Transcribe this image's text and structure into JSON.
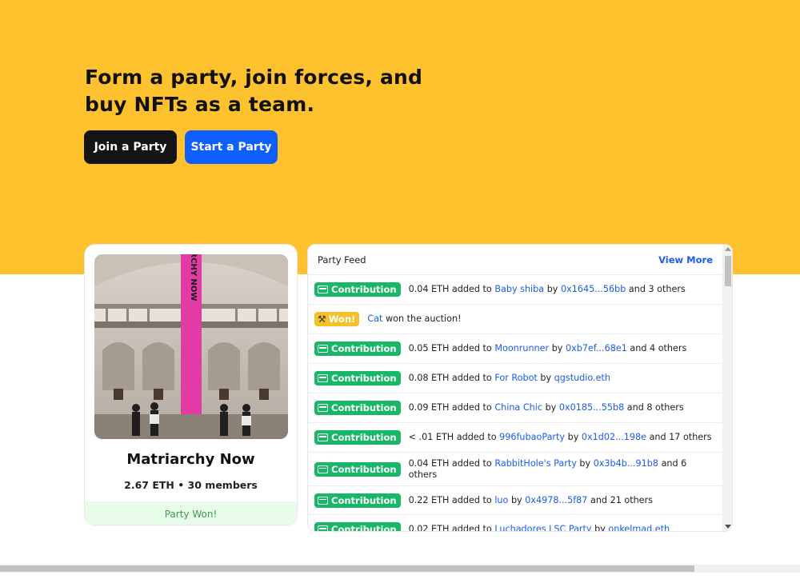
{
  "hero": {
    "title": "Form a party, join forces, and buy NFTs as a team.",
    "join_label": "Join a Party",
    "start_label": "Start a Party"
  },
  "party": {
    "name": "Matriarchy Now",
    "meta": "2.67 ETH • 30 members",
    "status": "Party Won!",
    "banner_text": "MATRIARCHY NOW"
  },
  "feed": {
    "title": "Party Feed",
    "view_more": "View More",
    "items": [
      {
        "badge": "Contribution",
        "amount": "0.04 ETH added to",
        "party": "Baby shiba",
        "by": "by",
        "user": "0x1645...56bb",
        "others": "and 3 others"
      },
      {
        "badge": "Won!",
        "party": "Cat",
        "rest": "won the auction!"
      },
      {
        "badge": "Contribution",
        "amount": "0.05 ETH added to",
        "party": "Moonrunner",
        "by": "by",
        "user": "0xb7ef...68e1",
        "others": "and 4 others"
      },
      {
        "badge": "Contribution",
        "amount": "0.08 ETH added to",
        "party": "For Robot",
        "by": "by",
        "user": "qgstudio.eth",
        "others": ""
      },
      {
        "badge": "Contribution",
        "amount": "0.09 ETH added to",
        "party": "China Chic",
        "by": "by",
        "user": "0x0185...55b8",
        "others": "and 8 others"
      },
      {
        "badge": "Contribution",
        "amount": "< .01 ETH added to",
        "party": "996fubaoParty",
        "by": "by",
        "user": "0x1d02...198e",
        "others": "and 17 others"
      },
      {
        "badge": "Contribution",
        "amount": "0.04 ETH added to",
        "party": "RabbitHole's Party",
        "by": "by",
        "user": "0x3b4b...91b8",
        "others": "and 6 others"
      },
      {
        "badge": "Contribution",
        "amount": "0.22 ETH added to",
        "party": "luo",
        "by": "by",
        "user": "0x4978...5f87",
        "others": "and 21 others"
      },
      {
        "badge": "Contribution",
        "amount": "0.02 ETH added to",
        "party": "Luchadores LSC Party",
        "by": "by",
        "user": "onkelmad.eth",
        "others": ""
      }
    ]
  },
  "colors": {
    "hero_bg": "#fec22f",
    "primary_blue": "#0f5fff",
    "contribution_green": "#18b768",
    "won_yellow": "#f5c02a",
    "link_blue": "#1a5cf0"
  }
}
